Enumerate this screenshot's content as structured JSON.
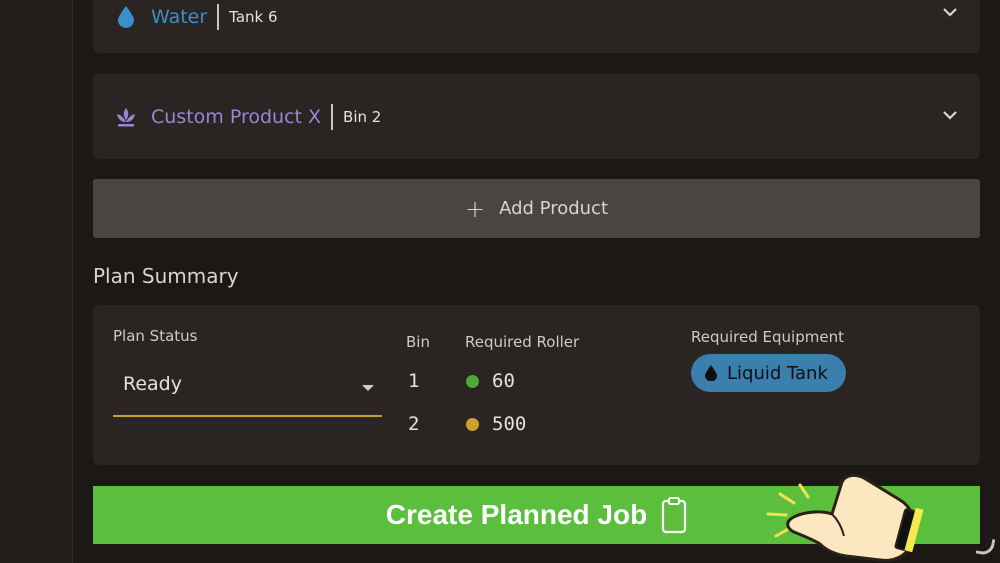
{
  "products": [
    {
      "name": "Water",
      "location": "Tank 6",
      "icon": "water-drop-icon",
      "color": "#3d8fc9"
    },
    {
      "name": "Custom Product X",
      "location": "Bin 2",
      "icon": "plant-icon",
      "color": "#9a86d6"
    }
  ],
  "add_product": {
    "label": "Add Product",
    "icon": "plus-icon"
  },
  "plan_summary": {
    "title": "Plan Summary",
    "status_label": "Plan Status",
    "status_value": "Ready",
    "bin_header": "Bin",
    "roller_header": "Required Roller",
    "rows": [
      {
        "bin": "1",
        "roller": "60",
        "dot_color": "#4fa83a"
      },
      {
        "bin": "2",
        "roller": "500",
        "dot_color": "#c9a227"
      }
    ],
    "equipment_header": "Required Equipment",
    "equipment": {
      "label": "Liquid Tank",
      "icon": "liquid-drop-icon",
      "color": "#3b7fae"
    }
  },
  "create_button": {
    "label": "Create Planned Job",
    "icon": "clipboard-icon",
    "color": "#5bbf3d"
  },
  "pointer": {
    "icon": "pointing-hand-icon"
  }
}
